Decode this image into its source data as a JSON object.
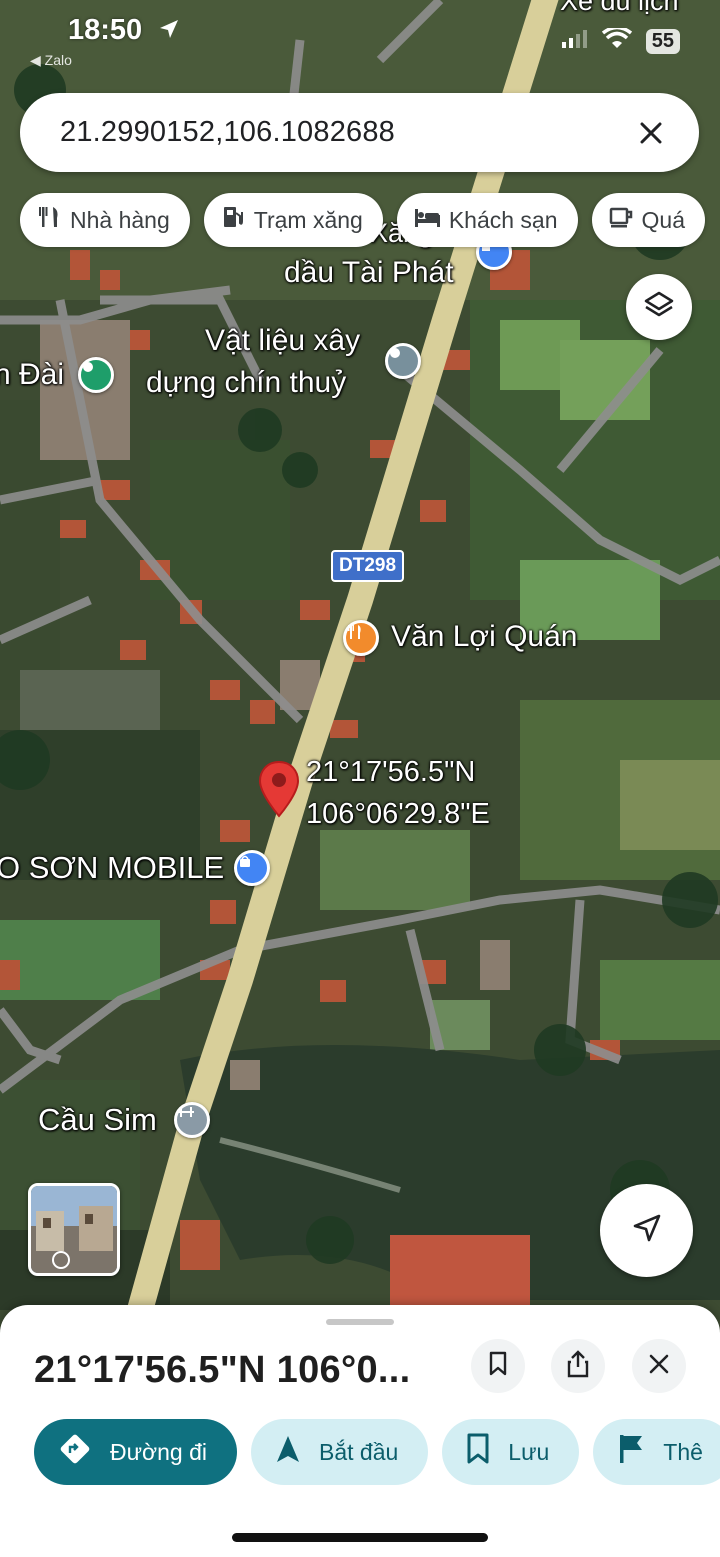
{
  "status": {
    "time": "18:50",
    "back_app": "◀ Zalo",
    "battery": "55"
  },
  "search": {
    "query": "21.2990152,106.1082688"
  },
  "chips": [
    {
      "label": "Nhà hàng",
      "icon": "restaurant-icon"
    },
    {
      "label": "Trạm xăng",
      "icon": "gas-station-icon"
    },
    {
      "label": "Khách sạn",
      "icon": "hotel-icon"
    },
    {
      "label": "Quá",
      "icon": "cafe-icon"
    }
  ],
  "map": {
    "top_partial": "Xe du lịch",
    "labels": {
      "tai_phat_1": "Xăng",
      "tai_phat_2": "dầu Tài Phát",
      "vat_lieu_1": "Vật liệu xây",
      "vat_lieu_2": "dựng chín thuỷ",
      "left_dai": "n Đài",
      "road_shield": "DT298",
      "van_loi": "Văn Lợi Quán",
      "coord_lat": "21°17'56.5\"N",
      "coord_lng": "106°06'29.8\"E",
      "son_mobile": "O SƠN MOBILE",
      "cau_sim": "Cầu Sim"
    }
  },
  "sheet": {
    "title": "21°17'56.5\"N 106°0...",
    "actions": [
      {
        "label": "Đường đi",
        "icon": "directions-icon"
      },
      {
        "label": "Bắt đầu",
        "icon": "navigation-icon"
      },
      {
        "label": "Lưu",
        "icon": "bookmark-icon"
      },
      {
        "label": "Thê",
        "icon": "flag-icon"
      }
    ]
  },
  "colors": {
    "accent": "#0f7180",
    "pin_red": "#e53935",
    "poi_green": "#1e9e6a",
    "poi_blue": "#4285f4",
    "poi_orange": "#f28b2c"
  }
}
